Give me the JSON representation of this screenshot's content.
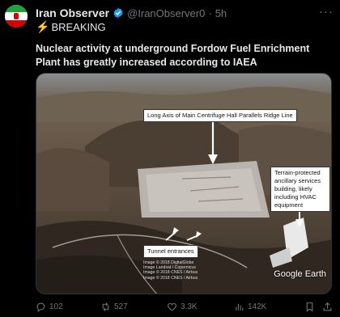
{
  "author": {
    "name": "Iran Observer",
    "handle": "@IranObserver0",
    "separator": "·",
    "time": "5h",
    "more": "···"
  },
  "tweet": {
    "breaking": "BREAKING",
    "text": "Nuclear activity at underground Fordow Fuel Enrichment Plant has greatly increased according to IAEA"
  },
  "media": {
    "callout_axis": "Long Axis of Main Centrifuge Hall Parallels Ridge Line",
    "callout_terrain": "Terrain-protected ancillary services building, likely including HVAC equipment",
    "callout_tunnel": "Tunnel entrances",
    "credits": "Image © 2018 DigitalGlobe\nImage Landsat / Copernicus\nImage © 2018 CNES / Airbus\nImage © 2018 CNES / Airbus",
    "watermark": "Google Earth"
  },
  "actions": {
    "replies": "102",
    "reposts": "527",
    "likes": "3.3K",
    "views": "142K"
  },
  "colors": {
    "background": "#000000",
    "text": "#e7e9ea",
    "muted": "#71767b",
    "verified": "#1d9bf0"
  }
}
